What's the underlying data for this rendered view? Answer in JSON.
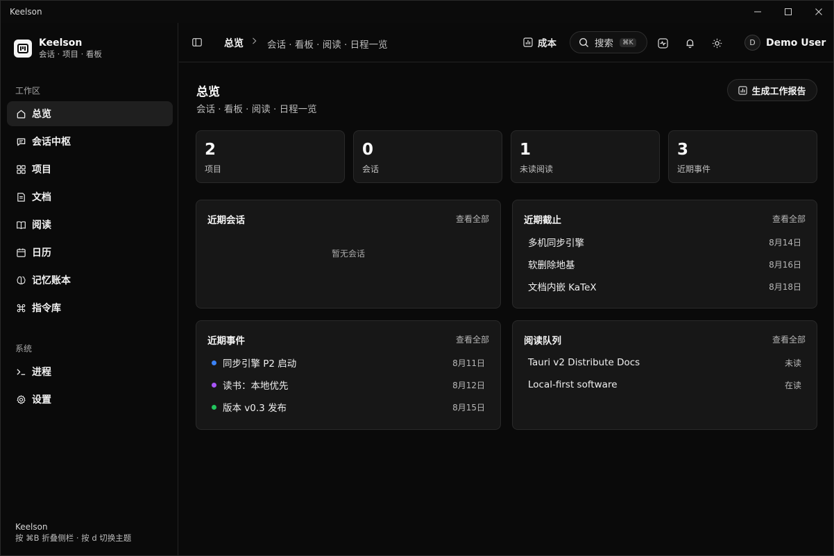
{
  "window": {
    "title": "Keelson"
  },
  "sidebar": {
    "brand_name": "Keelson",
    "brand_sub": "会话 · 项目 · 看板",
    "workspace_label": "工作区",
    "items": [
      {
        "label": "总览",
        "icon": "home-icon"
      },
      {
        "label": "会话中枢",
        "icon": "chat-icon"
      },
      {
        "label": "项目",
        "icon": "grid-icon"
      },
      {
        "label": "文档",
        "icon": "document-icon"
      },
      {
        "label": "阅读",
        "icon": "book-icon"
      },
      {
        "label": "日历",
        "icon": "calendar-icon"
      },
      {
        "label": "记忆账本",
        "icon": "brain-icon"
      },
      {
        "label": "指令库",
        "icon": "command-icon"
      }
    ],
    "system_label": "系统",
    "system_items": [
      {
        "label": "进程",
        "icon": "terminal-icon"
      },
      {
        "label": "设置",
        "icon": "gear-icon"
      }
    ],
    "footer_name": "Keelson",
    "footer_hint": "按 ⌘B 折叠侧栏 · 按 d 切换主题"
  },
  "topbar": {
    "breadcrumb_current": "总览",
    "breadcrumb_sub": "会话 · 看板 · 阅读 · 日程一览",
    "cost_label": "成本",
    "search_label": "搜索",
    "search_shortcut": "⌘K",
    "user_initial": "D",
    "user_name": "Demo User"
  },
  "page": {
    "title": "总览",
    "subtitle": "会话 · 看板 · 阅读 · 日程一览",
    "report_button": "生成工作报告"
  },
  "stats": [
    {
      "value": "2",
      "label": "项目"
    },
    {
      "value": "0",
      "label": "会话"
    },
    {
      "value": "1",
      "label": "未读阅读"
    },
    {
      "value": "3",
      "label": "近期事件"
    }
  ],
  "cards": {
    "sessions": {
      "title": "近期会话",
      "link": "查看全部",
      "empty": "暂无会话"
    },
    "deadlines": {
      "title": "近期截止",
      "link": "查看全部",
      "items": [
        {
          "name": "多机同步引擎",
          "date": "8月14日"
        },
        {
          "name": "软删除地基",
          "date": "8月16日"
        },
        {
          "name": "文档内嵌 KaTeX",
          "date": "8月18日"
        }
      ]
    },
    "events": {
      "title": "近期事件",
      "link": "查看全部",
      "items": [
        {
          "name": "同步引擎 P2 启动",
          "date": "8月11日",
          "color": "#3b82f6"
        },
        {
          "name": "读书：本地优先",
          "date": "8月12日",
          "color": "#a855f7"
        },
        {
          "name": "版本 v0.3 发布",
          "date": "8月15日",
          "color": "#22c55e"
        }
      ]
    },
    "reading": {
      "title": "阅读队列",
      "link": "查看全部",
      "items": [
        {
          "name": "Tauri v2 Distribute Docs",
          "status": "未读"
        },
        {
          "name": "Local-first software",
          "status": "在读"
        }
      ]
    }
  }
}
